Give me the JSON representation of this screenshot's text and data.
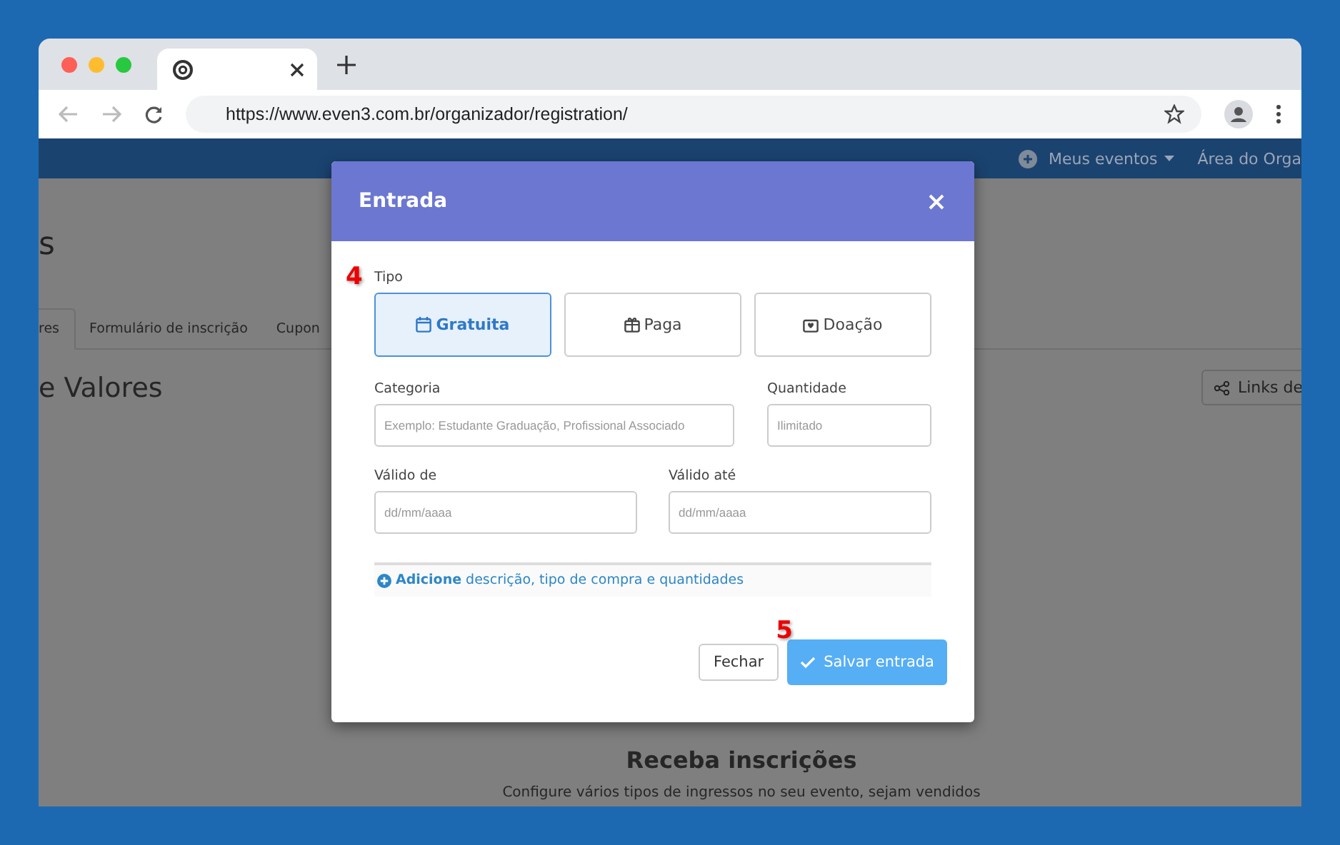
{
  "browser": {
    "url": "https://www.even3.com.br/organizador/registration/"
  },
  "nav": {
    "items": [
      "Meus eventos",
      "Área do Orga"
    ]
  },
  "page": {
    "title_fragment": "s",
    "tabs": [
      {
        "label": "res",
        "selected": true
      },
      {
        "label": "Formulário de inscrição",
        "selected": false
      },
      {
        "label": "Cupon",
        "selected": false
      }
    ],
    "heading": "e Valores",
    "links_button": "Links de",
    "empty_title": "Receba inscrições",
    "empty_text": "Configure vários tipos de ingressos no seu evento, sejam vendidos"
  },
  "modal": {
    "title": "Entrada",
    "type_label": "Tipo",
    "types": [
      {
        "label": "Gratuita",
        "kind": "free",
        "selected": true
      },
      {
        "label": "Paga",
        "kind": "paid",
        "selected": false
      },
      {
        "label": "Doação",
        "kind": "donation",
        "selected": false
      }
    ],
    "category": {
      "label": "Categoria",
      "placeholder": "Exemplo: Estudante Graduação, Profissional Associado"
    },
    "quantity": {
      "label": "Quantidade",
      "placeholder": "Ilimitado"
    },
    "valid_from": {
      "label": "Válido de",
      "placeholder": "dd/mm/aaaa"
    },
    "valid_to": {
      "label": "Válido até",
      "placeholder": "dd/mm/aaaa"
    },
    "add_link": "**Adicione** descrição, tipo de compra e quantidades",
    "close_button": "Fechar",
    "save_button": "Salvar entrada"
  },
  "annotations": [
    "4",
    "5"
  ]
}
